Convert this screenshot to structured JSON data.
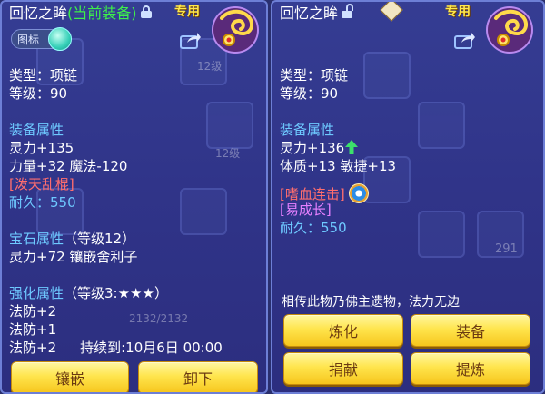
{
  "left": {
    "title": "回忆之眸",
    "current_tag": "(当前装备)",
    "exclusive_label": "专用",
    "tag_toggle_label": "图标",
    "type_line": "类型：项链",
    "level_line": "等级：90",
    "equip_attr_header": "装备属性",
    "attrs": [
      "灵力+135",
      "力量+32 魔法-120"
    ],
    "skill": "[泼天乱棍]",
    "durability_label": "耐久：",
    "durability_value": "550",
    "gem_header": "宝石属性",
    "gem_level": "（等级12）",
    "gem_line": "灵力+72 镶嵌舍利子",
    "enhance_header": "强化属性",
    "enhance_level": "（等级3:★★★）",
    "enhance_lines": [
      "法防+2",
      "法防+1"
    ],
    "enhance_timed": "法防+2",
    "duration_text": "持续到:10月6日 00:00",
    "ghost_stats": "2132/2132",
    "ghost_levels": [
      "12级",
      "12级"
    ],
    "buttons": {
      "inlay": "镶嵌",
      "unequip": "卸下"
    }
  },
  "right": {
    "title": "回忆之眸",
    "exclusive_label": "专用",
    "type_line": "类型：项链",
    "level_line": "等级：90",
    "equip_attr_header": "装备属性",
    "attr1": "灵力+136",
    "attr2": "体质+13 敏捷+13",
    "skill1": "[嗜血连击]",
    "skill2": "[易成长]",
    "durability_label": "耐久：",
    "durability_value": "550",
    "ghost_count": "291",
    "description": "相传此物乃佛主遗物，法力无边",
    "buttons": {
      "refine": "炼化",
      "equip": "装备",
      "donate": "捐献",
      "extract": "提炼"
    }
  }
}
